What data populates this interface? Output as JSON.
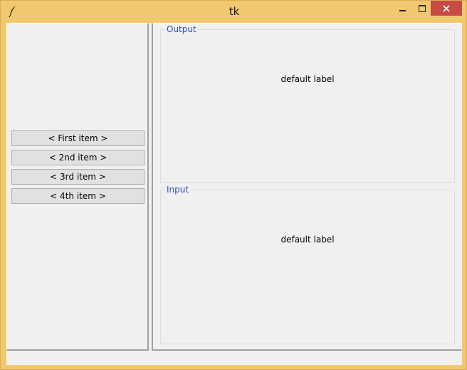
{
  "window": {
    "title": "tk",
    "icon": "feather-icon",
    "controls": [
      "minimize-icon",
      "maximize-icon",
      "close-icon"
    ],
    "close_color": "#c74b44",
    "frame_color": "#f0c870"
  },
  "sidebar": {
    "items": [
      {
        "label": "< First item >"
      },
      {
        "label": "< 2nd item >"
      },
      {
        "label": "< 3rd item >"
      },
      {
        "label": "< 4th item >"
      }
    ]
  },
  "output": {
    "title": "Output",
    "label": "default label"
  },
  "input": {
    "title": "Input",
    "label": "default label"
  },
  "colors": {
    "frame_title": "#2c50b8",
    "background": "#f0f0f0"
  }
}
